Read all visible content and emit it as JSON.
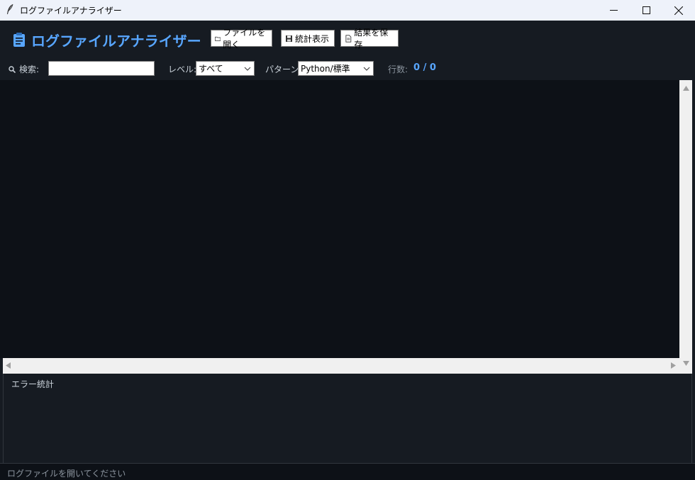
{
  "window": {
    "title": "ログファイルアナライザー"
  },
  "header": {
    "app_title": "ログファイルアナライザー",
    "buttons": {
      "open": "ファイルを開く",
      "stats": "統計表示",
      "save": "結果を保存"
    }
  },
  "filters": {
    "search_label": "検索:",
    "search_value": "",
    "level_label": "レベル:",
    "level_selected": "すべて",
    "pattern_label": "パターン:",
    "pattern_selected": "Python/標準",
    "rows_label": "行数:",
    "rows_value": "0 / 0"
  },
  "stats_panel": {
    "title": "エラー統計"
  },
  "status": {
    "message": "ログファイルを開いてください"
  },
  "colors": {
    "accent": "#58a6ff",
    "background": "#161b22",
    "log_background": "#0d1117"
  }
}
